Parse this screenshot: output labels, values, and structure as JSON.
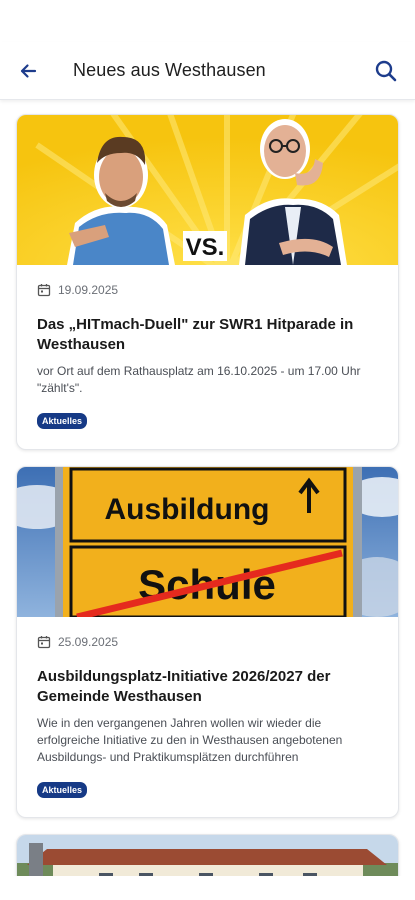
{
  "appbar": {
    "title": "Neues aus Westhausen",
    "back_icon": "arrow-left-icon",
    "search_icon": "search-icon",
    "accent_color": "#1d3c8c"
  },
  "articles": [
    {
      "date": "19.09.2025",
      "title": "Das „HITmach-Duell\" zur SWR1 Hitparade in Westhausen",
      "excerpt": "vor Ort auf dem Rathausplatz am 16.10.2025 - um 17.00 Uhr \"zählt's\".",
      "tag": "Aktuelles",
      "image_text": "VS."
    },
    {
      "date": "25.09.2025",
      "title": "Ausbildungsplatz-Initiative 2026/2027 der Gemeinde Westhausen",
      "excerpt": "Wie in den vergangenen Jahren wollen wir wieder die erfolgreiche Initiative zu den in Westhausen angebotenen Ausbildungs- und Praktikumsplätzen durchführen",
      "tag": "Aktuelles",
      "sign_top": "Ausbildung",
      "sign_bottom": "Schule"
    }
  ],
  "tag_color": "#163a86"
}
